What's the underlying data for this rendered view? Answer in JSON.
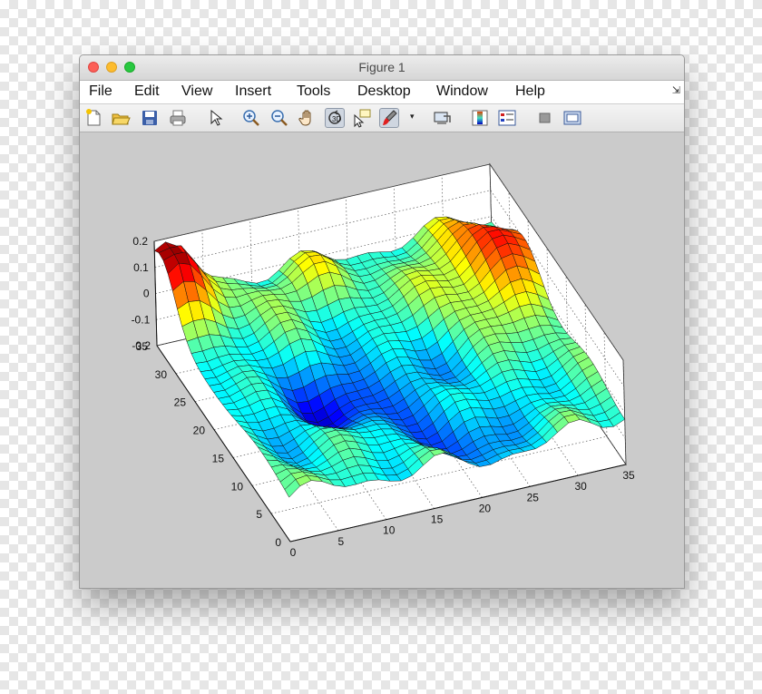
{
  "window": {
    "title": "Figure 1"
  },
  "menu": [
    {
      "label": "File"
    },
    {
      "label": "Edit"
    },
    {
      "label": "View"
    },
    {
      "label": "Insert"
    },
    {
      "label": "Tools"
    },
    {
      "label": "Desktop"
    },
    {
      "label": "Window"
    },
    {
      "label": "Help"
    }
  ],
  "toolbar": [
    {
      "icon": "new-figure-icon"
    },
    {
      "icon": "open-file-icon"
    },
    {
      "icon": "save-icon"
    },
    {
      "icon": "print-icon"
    },
    {
      "icon": "edit-plot-icon"
    },
    {
      "icon": "zoom-in-icon"
    },
    {
      "icon": "zoom-out-icon"
    },
    {
      "icon": "pan-icon"
    },
    {
      "icon": "rotate-3d-icon"
    },
    {
      "icon": "data-cursor-icon"
    },
    {
      "icon": "brush-icon"
    },
    {
      "icon": "link-plot-icon"
    },
    {
      "icon": "insert-colorbar-icon"
    },
    {
      "icon": "insert-legend-icon"
    },
    {
      "icon": "hide-plot-tools-icon"
    },
    {
      "icon": "show-plot-tools-icon"
    }
  ],
  "chart_data": {
    "type": "surface",
    "colormap": "jet",
    "grid": true,
    "xlim": [
      0,
      35
    ],
    "ylim": [
      0,
      35
    ],
    "zlim": [
      -0.2,
      0.2
    ],
    "x_ticks": [
      "0",
      "5",
      "10",
      "15",
      "20",
      "25",
      "30",
      "35"
    ],
    "y_ticks": [
      "0",
      "5",
      "10",
      "15",
      "20",
      "25",
      "30",
      "35"
    ],
    "z_ticks": [
      "-0.2",
      "-0.1",
      "0",
      "0.1",
      "0.2"
    ],
    "grid_size": [
      31,
      31
    ]
  }
}
